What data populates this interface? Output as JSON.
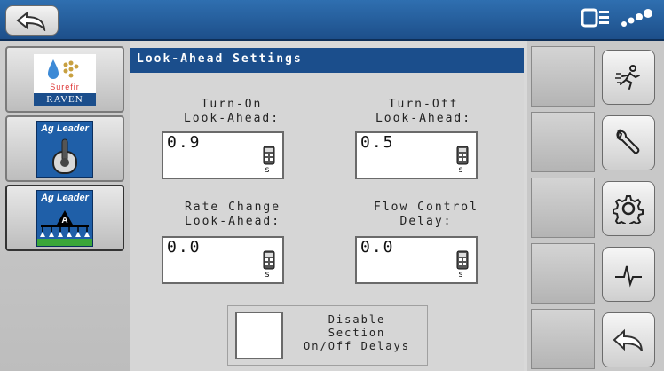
{
  "header": {
    "back_icon": "back-arrow-icon",
    "status_icons": [
      "display-icon",
      "gps-signal-icon"
    ]
  },
  "products": [
    {
      "name": "raven-surefire",
      "text_top": "Surefir",
      "text_bottom": "RAVEN",
      "icon": "surefire-logo-icon"
    },
    {
      "name": "ag-leader-switch",
      "brand": "Ag Leader",
      "icon": "toggle-switch-icon"
    },
    {
      "name": "ag-leader-boom",
      "brand": "Ag Leader",
      "icon": "sprayer-boom-icon"
    }
  ],
  "settings": {
    "title": "Look-Ahead Settings",
    "turn_on": {
      "label": "Turn-On\nLook-Ahead:",
      "value": "0.9",
      "unit": "s"
    },
    "turn_off": {
      "label": "Turn-Off\nLook-Ahead:",
      "value": "0.5",
      "unit": "s"
    },
    "rate_change": {
      "label": "Rate Change\nLook-Ahead:",
      "value": "0.0",
      "unit": "s"
    },
    "flow_control": {
      "label": "Flow Control\nDelay:",
      "value": "0.0",
      "unit": "s"
    },
    "disable_delays": {
      "label": "Disable\nSection\nOn/Off Delays",
      "checked": false
    }
  },
  "sidebar_buttons": [
    "runner-icon",
    "wrench-icon",
    "gear-icon",
    "pulse-icon",
    "back-arrow-icon"
  ],
  "colors": {
    "header_blue": "#1d4f8a",
    "title_blue": "#1b4e8c",
    "agleader_blue": "#1f5fa8"
  }
}
